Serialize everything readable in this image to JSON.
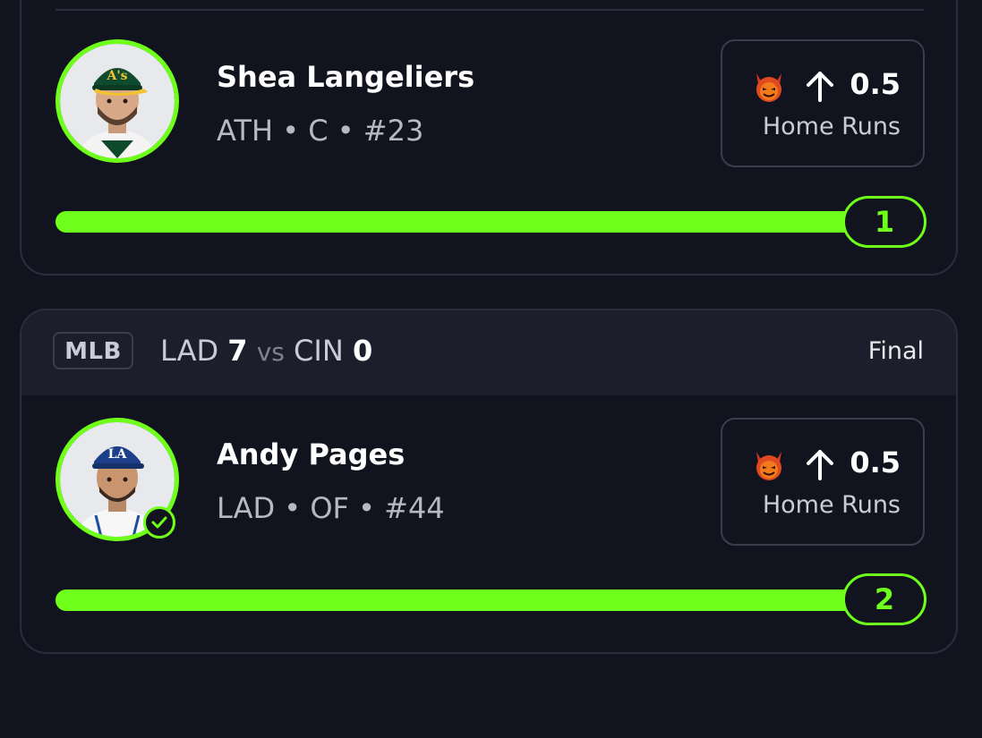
{
  "colors": {
    "background": "#11141f",
    "card_border": "#2a2e3c",
    "accent_green": "#6eff1a",
    "header_bg": "#1c1f2b"
  },
  "picks": [
    {
      "player_name": "Shea Langeliers",
      "player_meta": "ATH • C • #23",
      "avatar_icon": "player-headshot-athletics",
      "settled_check": false,
      "prop": {
        "icon": "devil-icon",
        "direction_icon": "arrow-up-icon",
        "line": "0.5",
        "stat": "Home Runs"
      },
      "progress": {
        "value": "1",
        "fill_fraction": 1.0
      }
    },
    {
      "game": {
        "league": "MLB",
        "away_team": "LAD",
        "away_score": "7",
        "vs": "vs",
        "home_team": "CIN",
        "home_score": "0",
        "status": "Final"
      },
      "player_name": "Andy Pages",
      "player_meta": "LAD • OF • #44",
      "avatar_icon": "player-headshot-dodgers",
      "settled_check": true,
      "prop": {
        "icon": "devil-icon",
        "direction_icon": "arrow-up-icon",
        "line": "0.5",
        "stat": "Home Runs"
      },
      "progress": {
        "value": "2",
        "fill_fraction": 1.0
      }
    }
  ]
}
